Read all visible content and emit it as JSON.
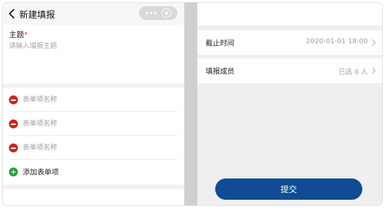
{
  "nav": {
    "title": "新建填报",
    "back_icon": "back-arrow-icon",
    "capsule_menu_icon": "more-dots-icon",
    "capsule_close_icon": "close-circle-icon"
  },
  "subject": {
    "label": "主题",
    "required_mark": "*",
    "placeholder": "请输入填报主题"
  },
  "form_items": {
    "items": [
      {
        "placeholder": "表单项名称",
        "icon": "remove-circle-icon"
      },
      {
        "placeholder": "表单项名称",
        "icon": "remove-circle-icon"
      },
      {
        "placeholder": "表单项名称",
        "icon": "remove-circle-icon"
      }
    ],
    "add_label": "添加表单项",
    "add_icon": "add-circle-icon"
  },
  "deadline": {
    "label": "截止时间",
    "value": "2020-01-01 18:00"
  },
  "members": {
    "label": "填报成员",
    "value": "已选 0 人"
  },
  "submit_label": "提交",
  "colors": {
    "primary": "#0f4c94",
    "remove": "#c62828",
    "add": "#2e9e3e",
    "required": "#e53935",
    "placeholder": "#a6a6a6"
  }
}
